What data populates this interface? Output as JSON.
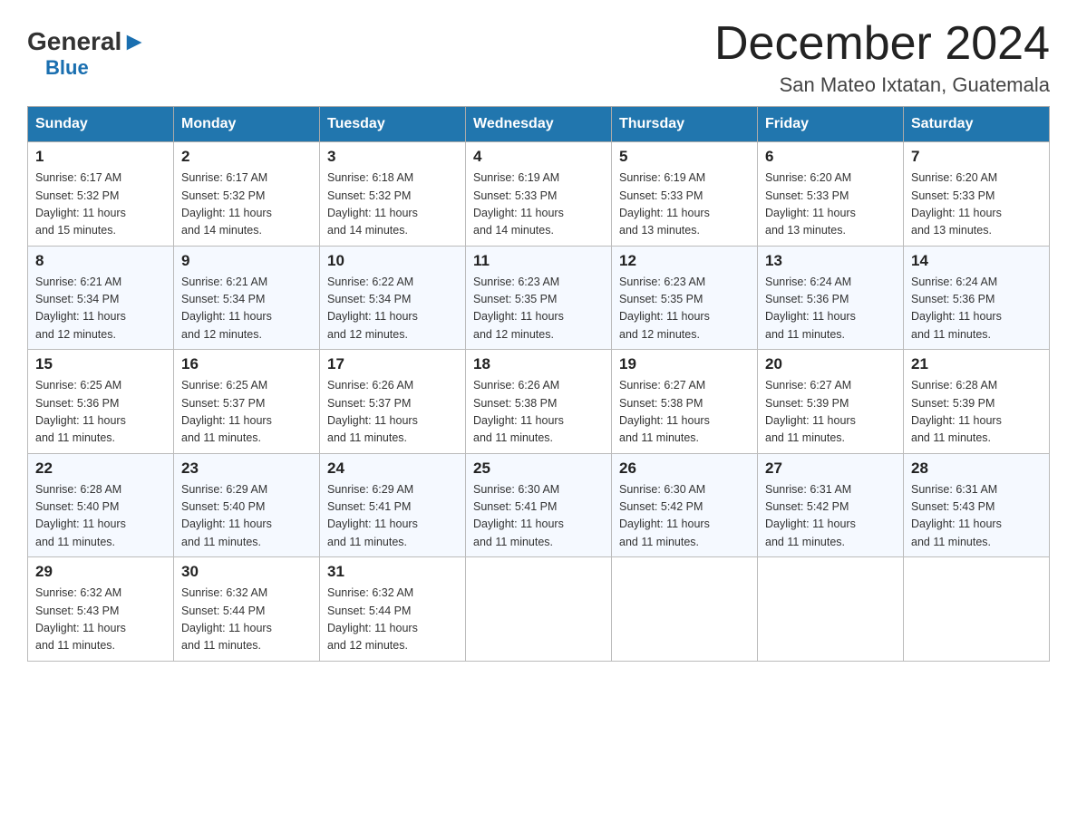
{
  "logo": {
    "general": "General",
    "blue": "Blue"
  },
  "title": "December 2024",
  "location": "San Mateo Ixtatan, Guatemala",
  "days_of_week": [
    "Sunday",
    "Monday",
    "Tuesday",
    "Wednesday",
    "Thursday",
    "Friday",
    "Saturday"
  ],
  "weeks": [
    [
      {
        "day": 1,
        "sunrise": "6:17 AM",
        "sunset": "5:32 PM",
        "daylight": "11 hours and 15 minutes."
      },
      {
        "day": 2,
        "sunrise": "6:17 AM",
        "sunset": "5:32 PM",
        "daylight": "11 hours and 14 minutes."
      },
      {
        "day": 3,
        "sunrise": "6:18 AM",
        "sunset": "5:32 PM",
        "daylight": "11 hours and 14 minutes."
      },
      {
        "day": 4,
        "sunrise": "6:19 AM",
        "sunset": "5:33 PM",
        "daylight": "11 hours and 14 minutes."
      },
      {
        "day": 5,
        "sunrise": "6:19 AM",
        "sunset": "5:33 PM",
        "daylight": "11 hours and 13 minutes."
      },
      {
        "day": 6,
        "sunrise": "6:20 AM",
        "sunset": "5:33 PM",
        "daylight": "11 hours and 13 minutes."
      },
      {
        "day": 7,
        "sunrise": "6:20 AM",
        "sunset": "5:33 PM",
        "daylight": "11 hours and 13 minutes."
      }
    ],
    [
      {
        "day": 8,
        "sunrise": "6:21 AM",
        "sunset": "5:34 PM",
        "daylight": "11 hours and 12 minutes."
      },
      {
        "day": 9,
        "sunrise": "6:21 AM",
        "sunset": "5:34 PM",
        "daylight": "11 hours and 12 minutes."
      },
      {
        "day": 10,
        "sunrise": "6:22 AM",
        "sunset": "5:34 PM",
        "daylight": "11 hours and 12 minutes."
      },
      {
        "day": 11,
        "sunrise": "6:23 AM",
        "sunset": "5:35 PM",
        "daylight": "11 hours and 12 minutes."
      },
      {
        "day": 12,
        "sunrise": "6:23 AM",
        "sunset": "5:35 PM",
        "daylight": "11 hours and 12 minutes."
      },
      {
        "day": 13,
        "sunrise": "6:24 AM",
        "sunset": "5:36 PM",
        "daylight": "11 hours and 11 minutes."
      },
      {
        "day": 14,
        "sunrise": "6:24 AM",
        "sunset": "5:36 PM",
        "daylight": "11 hours and 11 minutes."
      }
    ],
    [
      {
        "day": 15,
        "sunrise": "6:25 AM",
        "sunset": "5:36 PM",
        "daylight": "11 hours and 11 minutes."
      },
      {
        "day": 16,
        "sunrise": "6:25 AM",
        "sunset": "5:37 PM",
        "daylight": "11 hours and 11 minutes."
      },
      {
        "day": 17,
        "sunrise": "6:26 AM",
        "sunset": "5:37 PM",
        "daylight": "11 hours and 11 minutes."
      },
      {
        "day": 18,
        "sunrise": "6:26 AM",
        "sunset": "5:38 PM",
        "daylight": "11 hours and 11 minutes."
      },
      {
        "day": 19,
        "sunrise": "6:27 AM",
        "sunset": "5:38 PM",
        "daylight": "11 hours and 11 minutes."
      },
      {
        "day": 20,
        "sunrise": "6:27 AM",
        "sunset": "5:39 PM",
        "daylight": "11 hours and 11 minutes."
      },
      {
        "day": 21,
        "sunrise": "6:28 AM",
        "sunset": "5:39 PM",
        "daylight": "11 hours and 11 minutes."
      }
    ],
    [
      {
        "day": 22,
        "sunrise": "6:28 AM",
        "sunset": "5:40 PM",
        "daylight": "11 hours and 11 minutes."
      },
      {
        "day": 23,
        "sunrise": "6:29 AM",
        "sunset": "5:40 PM",
        "daylight": "11 hours and 11 minutes."
      },
      {
        "day": 24,
        "sunrise": "6:29 AM",
        "sunset": "5:41 PM",
        "daylight": "11 hours and 11 minutes."
      },
      {
        "day": 25,
        "sunrise": "6:30 AM",
        "sunset": "5:41 PM",
        "daylight": "11 hours and 11 minutes."
      },
      {
        "day": 26,
        "sunrise": "6:30 AM",
        "sunset": "5:42 PM",
        "daylight": "11 hours and 11 minutes."
      },
      {
        "day": 27,
        "sunrise": "6:31 AM",
        "sunset": "5:42 PM",
        "daylight": "11 hours and 11 minutes."
      },
      {
        "day": 28,
        "sunrise": "6:31 AM",
        "sunset": "5:43 PM",
        "daylight": "11 hours and 11 minutes."
      }
    ],
    [
      {
        "day": 29,
        "sunrise": "6:32 AM",
        "sunset": "5:43 PM",
        "daylight": "11 hours and 11 minutes."
      },
      {
        "day": 30,
        "sunrise": "6:32 AM",
        "sunset": "5:44 PM",
        "daylight": "11 hours and 11 minutes."
      },
      {
        "day": 31,
        "sunrise": "6:32 AM",
        "sunset": "5:44 PM",
        "daylight": "11 hours and 12 minutes."
      },
      null,
      null,
      null,
      null
    ]
  ],
  "labels": {
    "sunrise_prefix": "Sunrise: ",
    "sunset_prefix": "Sunset: ",
    "daylight_prefix": "Daylight: "
  }
}
